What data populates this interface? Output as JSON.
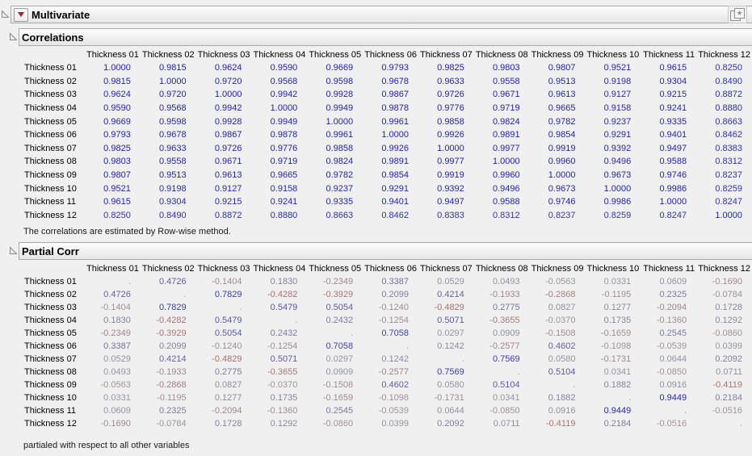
{
  "window": {
    "title": "Multivariate"
  },
  "icons": {
    "disclosure": "open-disclosure-triangle",
    "red_triangle_menu": "red-triangle-menu",
    "window_star": "window-star-button"
  },
  "variables": [
    "Thickness 01",
    "Thickness 02",
    "Thickness 03",
    "Thickness 04",
    "Thickness 05",
    "Thickness 06",
    "Thickness 07",
    "Thickness 08",
    "Thickness 09",
    "Thickness 10",
    "Thickness 11",
    "Thickness 12"
  ],
  "correlations": {
    "title": "Correlations",
    "footnote": "The correlations are estimated by Row-wise method.",
    "matrix": [
      [
        1.0,
        0.9815,
        0.9624,
        0.959,
        0.9669,
        0.9793,
        0.9825,
        0.9803,
        0.9807,
        0.9521,
        0.9615,
        0.825
      ],
      [
        0.9815,
        1.0,
        0.972,
        0.9568,
        0.9598,
        0.9678,
        0.9633,
        0.9558,
        0.9513,
        0.9198,
        0.9304,
        0.849
      ],
      [
        0.9624,
        0.972,
        1.0,
        0.9942,
        0.9928,
        0.9867,
        0.9726,
        0.9671,
        0.9613,
        0.9127,
        0.9215,
        0.8872
      ],
      [
        0.959,
        0.9568,
        0.9942,
        1.0,
        0.9949,
        0.9878,
        0.9776,
        0.9719,
        0.9665,
        0.9158,
        0.9241,
        0.888
      ],
      [
        0.9669,
        0.9598,
        0.9928,
        0.9949,
        1.0,
        0.9961,
        0.9858,
        0.9824,
        0.9782,
        0.9237,
        0.9335,
        0.8663
      ],
      [
        0.9793,
        0.9678,
        0.9867,
        0.9878,
        0.9961,
        1.0,
        0.9926,
        0.9891,
        0.9854,
        0.9291,
        0.9401,
        0.8462
      ],
      [
        0.9825,
        0.9633,
        0.9726,
        0.9776,
        0.9858,
        0.9926,
        1.0,
        0.9977,
        0.9919,
        0.9392,
        0.9497,
        0.8383
      ],
      [
        0.9803,
        0.9558,
        0.9671,
        0.9719,
        0.9824,
        0.9891,
        0.9977,
        1.0,
        0.996,
        0.9496,
        0.9588,
        0.8312
      ],
      [
        0.9807,
        0.9513,
        0.9613,
        0.9665,
        0.9782,
        0.9854,
        0.9919,
        0.996,
        1.0,
        0.9673,
        0.9746,
        0.8237
      ],
      [
        0.9521,
        0.9198,
        0.9127,
        0.9158,
        0.9237,
        0.9291,
        0.9392,
        0.9496,
        0.9673,
        1.0,
        0.9986,
        0.8259
      ],
      [
        0.9615,
        0.9304,
        0.9215,
        0.9241,
        0.9335,
        0.9401,
        0.9497,
        0.9588,
        0.9746,
        0.9986,
        1.0,
        0.8247
      ],
      [
        0.825,
        0.849,
        0.8872,
        0.888,
        0.8663,
        0.8462,
        0.8383,
        0.8312,
        0.8237,
        0.8259,
        0.8247,
        1.0
      ]
    ]
  },
  "partial": {
    "title": "Partial Corr",
    "footnote": "partialed with respect to all other variables",
    "matrix": [
      [
        null,
        0.4726,
        -0.1404,
        0.183,
        -0.2349,
        0.3387,
        0.0529,
        0.0493,
        -0.0563,
        0.0331,
        0.0609,
        -0.169
      ],
      [
        0.4726,
        null,
        0.7829,
        -0.4282,
        -0.3929,
        0.2099,
        0.4214,
        -0.1933,
        -0.2868,
        -0.1195,
        0.2325,
        -0.0784
      ],
      [
        -0.1404,
        0.7829,
        null,
        0.5479,
        0.5054,
        -0.124,
        -0.4829,
        0.2775,
        0.0827,
        0.1277,
        -0.2094,
        0.1728
      ],
      [
        0.183,
        -0.4282,
        0.5479,
        null,
        0.2432,
        -0.1254,
        0.5071,
        -0.3655,
        -0.037,
        0.1735,
        -0.136,
        0.1292
      ],
      [
        -0.2349,
        -0.3929,
        0.5054,
        0.2432,
        null,
        0.7058,
        0.0297,
        0.0909,
        -0.1508,
        -0.1659,
        0.2545,
        -0.086
      ],
      [
        0.3387,
        0.2099,
        -0.124,
        -0.1254,
        0.7058,
        null,
        0.1242,
        -0.2577,
        0.4602,
        -0.1098,
        -0.0539,
        0.0399
      ],
      [
        0.0529,
        0.4214,
        -0.4829,
        0.5071,
        0.0297,
        0.1242,
        null,
        0.7569,
        0.058,
        -0.1731,
        0.0644,
        0.2092
      ],
      [
        0.0493,
        -0.1933,
        0.2775,
        -0.3655,
        0.0909,
        -0.2577,
        0.7569,
        null,
        0.5104,
        0.0341,
        -0.085,
        0.0711
      ],
      [
        -0.0563,
        -0.2868,
        0.0827,
        -0.037,
        -0.1508,
        0.4602,
        0.058,
        0.5104,
        null,
        0.1882,
        0.0916,
        -0.4119
      ],
      [
        0.0331,
        -0.1195,
        0.1277,
        0.1735,
        -0.1659,
        -0.1098,
        -0.1731,
        0.0341,
        0.1882,
        null,
        0.9449,
        0.2184
      ],
      [
        0.0609,
        0.2325,
        -0.2094,
        -0.136,
        0.2545,
        -0.0539,
        0.0644,
        -0.085,
        0.0916,
        0.9449,
        null,
        -0.0516
      ],
      [
        -0.169,
        -0.0784,
        0.1728,
        0.1292,
        -0.086,
        0.0399,
        0.2092,
        0.0711,
        -0.4119,
        0.2184,
        -0.0516,
        null
      ]
    ]
  },
  "colors": {
    "positive_strong": "#1e1eb4",
    "negative_strong": "#c23c3c",
    "neutral": "#9a9a9a",
    "red_triangle": "#b51d1d"
  },
  "missing_symbol": "."
}
